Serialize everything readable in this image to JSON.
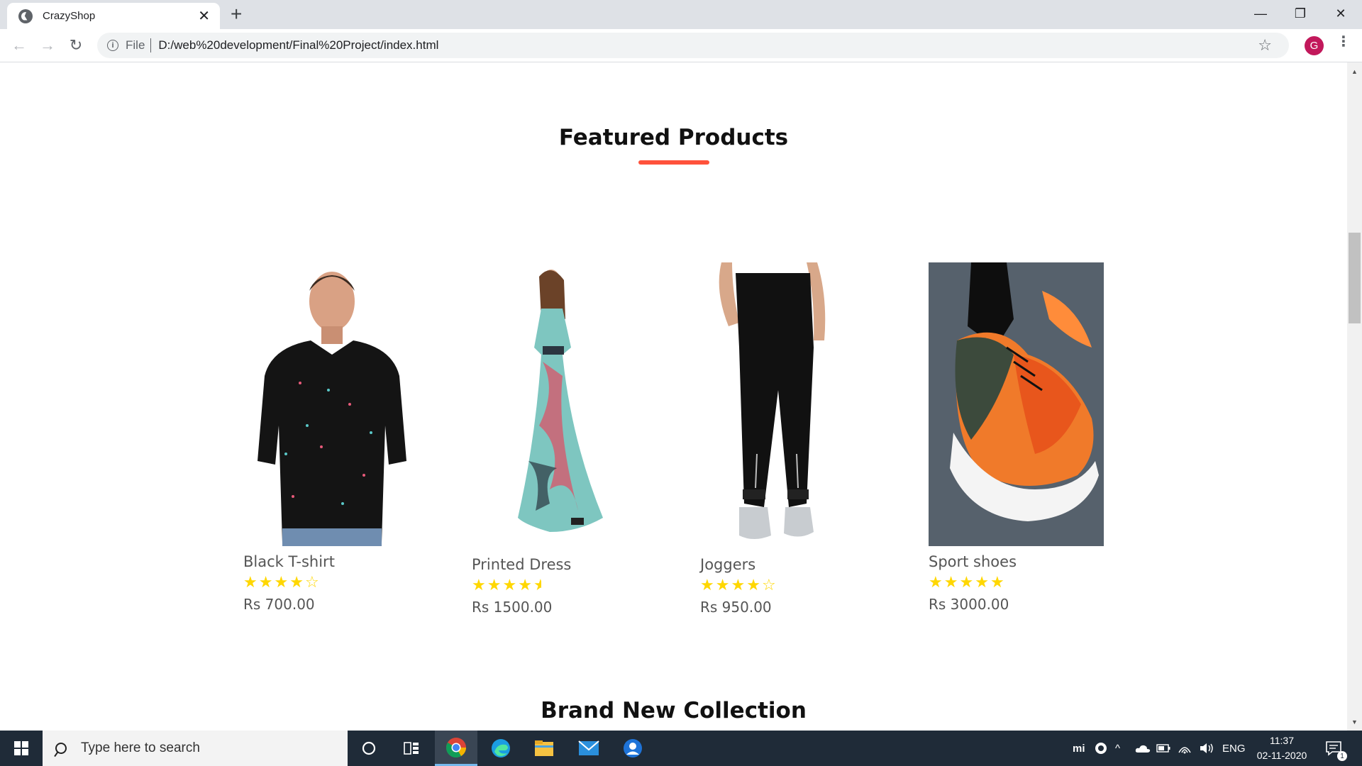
{
  "browser": {
    "tab_title": "CrazyShop",
    "address_scheme": "File",
    "address_url": "D:/web%20development/Final%20Project/index.html",
    "profile_initial": "G"
  },
  "page": {
    "featured_title": "Featured Products",
    "brand_title": "Brand New Collection",
    "accent_color": "#ff523b",
    "star_color": "#ffd700"
  },
  "products": [
    {
      "name": "Black T-shirt",
      "rating": 4,
      "price": "Rs 700.00"
    },
    {
      "name": "Printed Dress",
      "rating": 4.5,
      "price": "Rs 1500.00"
    },
    {
      "name": "Joggers",
      "rating": 4,
      "price": "Rs 950.00"
    },
    {
      "name": "Sport shoes",
      "rating": 5,
      "price": "Rs 3000.00"
    }
  ],
  "taskbar": {
    "search_placeholder": "Type here to search",
    "language": "ENG",
    "time": "11:37",
    "date": "02-11-2020",
    "notification_count": "1",
    "tray_brand": "mi"
  }
}
